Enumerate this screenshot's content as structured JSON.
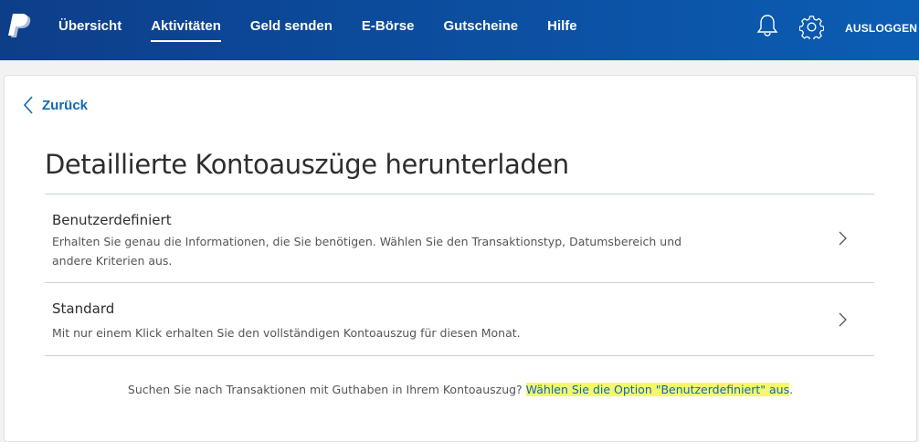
{
  "nav": {
    "items": [
      {
        "label": "Übersicht",
        "active": false
      },
      {
        "label": "Aktivitäten",
        "active": true
      },
      {
        "label": "Geld senden",
        "active": false
      },
      {
        "label": "E-Börse",
        "active": false
      },
      {
        "label": "Gutscheine",
        "active": false
      },
      {
        "label": "Hilfe",
        "active": false
      }
    ],
    "logout_label": "AUSLOGGEN",
    "icons": [
      "paypal-logo-icon",
      "bell-icon",
      "gear-icon"
    ]
  },
  "back_label": "Zurück",
  "page_title": "Detaillierte Kontoauszüge herunterladen",
  "options": [
    {
      "title": "Benutzerdefiniert",
      "description": "Erhalten Sie genau die Informationen, die Sie benötigen. Wählen Sie den Transaktionstyp, Datumsbereich und andere Kriterien aus."
    },
    {
      "title": "Standard",
      "description": "Mit nur einem Klick erhalten Sie den vollständigen Kontoauszug für diesen Monat."
    }
  ],
  "footer": {
    "text": "Suchen Sie nach Transaktionen mit Guthaben in Ihrem Kontoauszug? ",
    "link_first": "W",
    "link_rest": "ählen Sie die Option \"Benutzerdefiniert\" aus",
    "end": "."
  },
  "colors": {
    "header_gradient_start": "#0d3e8a",
    "header_gradient_end": "#0b5db4",
    "link": "#0f69b4",
    "highlight": "#f5f76f"
  }
}
